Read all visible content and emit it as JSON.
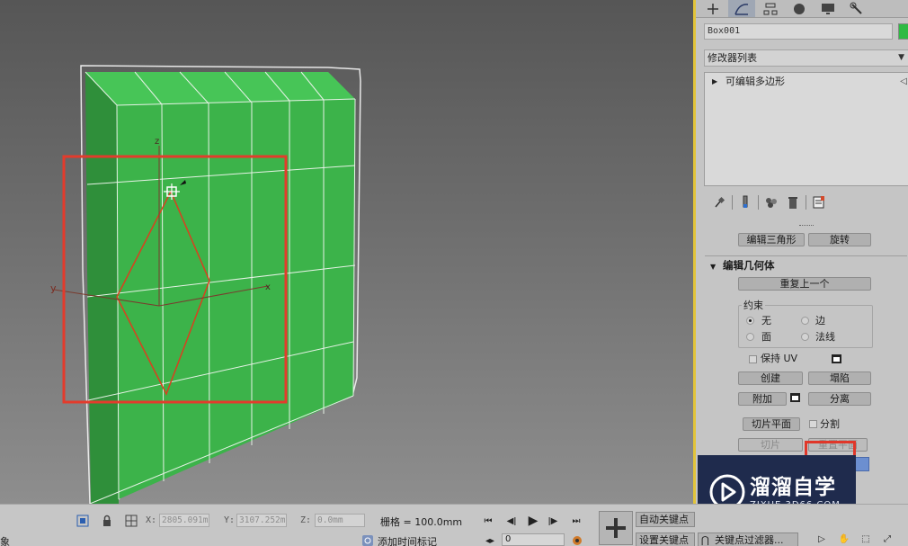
{
  "viewport": {
    "axis_x": "x",
    "axis_y": "y",
    "axis_z": "z"
  },
  "command_panel": {
    "tabs": [
      "create-icon",
      "modify-icon",
      "hierarchy-icon",
      "motion-icon",
      "display-icon",
      "utilities-icon"
    ],
    "active_tab": "modify-icon",
    "object_name": "Box001",
    "object_color": "#2fba43",
    "modifier_list_label": "修改器列表",
    "stack_item": "可编辑多边形",
    "stack_tools": [
      "pin-stack-icon",
      "show-end-result-icon",
      "make-unique-icon",
      "remove-modifier-icon",
      "configure-sets-icon"
    ],
    "top_buttons": {
      "edit_triangulation": "编辑三角形",
      "turn": "旋转"
    },
    "edit_geometry": {
      "title": "编辑几何体",
      "repeat_last": "重复上一个",
      "constraints_label": "约束",
      "constraints": {
        "none": "无",
        "edge": "边",
        "face": "面",
        "normal": "法线",
        "selected": "无"
      },
      "preserve_uvs": "保持 UV",
      "create": "创建",
      "collapse": "塌陷",
      "attach": "附加",
      "detach": "分离",
      "slice_plane": "切片平面",
      "split": "分割",
      "slice": "切片",
      "reset_plane": "重置平面"
    }
  },
  "watermark": {
    "title": "溜溜自学",
    "url": "ZIXUE.3D66.COM"
  },
  "status_bar": {
    "x_label": "X:",
    "x_value": "2805.091m",
    "y_label": "Y:",
    "y_value": "3107.252m",
    "z_label": "Z:",
    "z_value": "0.0mm",
    "grid": "栅格 = 100.0mm",
    "auto_key": "自动关键点",
    "set_key": "设置关键点",
    "key_filters": "关键点过滤器...",
    "frame_value": "0",
    "add_time_tag": "添加时间标记",
    "left_cut_text": "象"
  }
}
